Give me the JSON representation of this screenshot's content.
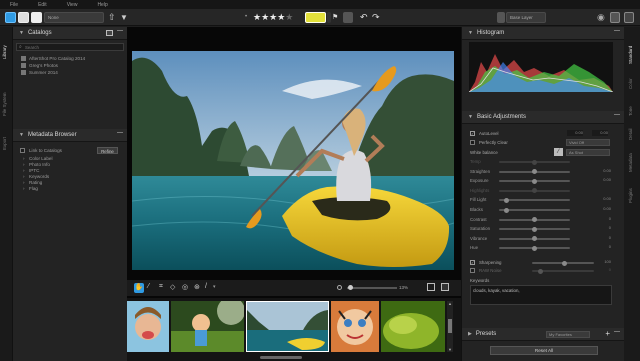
{
  "menu": [
    "File",
    "Edit",
    "View",
    "Help"
  ],
  "toolbar": {
    "view_mode_select": "None",
    "stars_filled": "★★★★",
    "stars_empty": "★",
    "layer_select": "Base Layer"
  },
  "left_tabs": [
    "Library",
    "File System",
    "Export"
  ],
  "catalogs": {
    "title": "Catalogs",
    "search_placeholder": "Search",
    "items": [
      "AfterShot Pro Catalog 2014",
      "Greg's Photos",
      "Summer 2014"
    ]
  },
  "metadata": {
    "title": "Metadata Browser",
    "link_label": "Link to Catalogs",
    "refine_button": "Refine",
    "items": [
      "Color Label",
      "Photo Info",
      "IPTC",
      "Keywords",
      "Rating",
      "Flag"
    ]
  },
  "center": {
    "zoom": "13%"
  },
  "histogram": {
    "title": "Histogram"
  },
  "basic": {
    "title": "Basic Adjustments",
    "autolevel": "AutoLevel",
    "autolevel_vals": [
      "0.00",
      "0.00"
    ],
    "perfectly_clear": "Perfectly Clear",
    "perfectly_clear_select": "Vivid Off",
    "white_balance": "White balance",
    "white_balance_select": "As Shot",
    "sliders": [
      {
        "label": "Temp",
        "value": "",
        "pos": 0.5,
        "dim": true
      },
      {
        "label": "Straighten",
        "value": "0.00",
        "pos": 0.5
      },
      {
        "label": "Exposure",
        "value": "0.00",
        "pos": 0.5
      },
      {
        "label": "Highlights",
        "value": "",
        "pos": 0.5,
        "dim": true
      },
      {
        "label": "Fill Light",
        "value": "0.00",
        "pos": 0.08
      },
      {
        "label": "Blacks",
        "value": "0.00",
        "pos": 0.08
      },
      {
        "label": "Contrast",
        "value": "0",
        "pos": 0.5
      },
      {
        "label": "Saturation",
        "value": "0",
        "pos": 0.5
      },
      {
        "label": "Vibrance",
        "value": "0",
        "pos": 0.5
      },
      {
        "label": "Hue",
        "value": "0",
        "pos": 0.5
      }
    ],
    "sharpening": "Sharpening",
    "sharpening_val": "100",
    "noise": "RAW Noise",
    "noise_val": "0",
    "keywords_label": "Keywords",
    "keywords_value": "clouds, kayak, vacation,"
  },
  "presets": {
    "title": "Presets",
    "select": "My Favorites",
    "reset_all": "Reset All"
  },
  "right_tabs": [
    "Standard",
    "Color",
    "Tone",
    "Detail",
    "Metadata",
    "Plugins"
  ]
}
